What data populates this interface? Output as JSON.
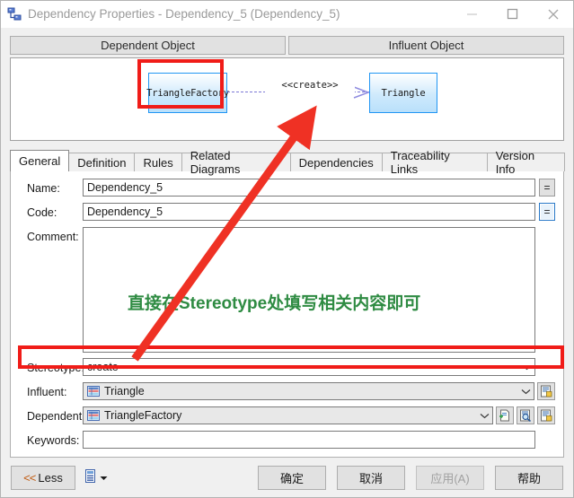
{
  "window": {
    "title": "Dependency Properties - Dependency_5 (Dependency_5)",
    "icon": "dependency-icon",
    "minimize_label": "minimize-icon",
    "maximize_label": "maximize-icon",
    "close_label": "close-icon"
  },
  "object_header": {
    "dependent_label": "Dependent Object",
    "influent_label": "Influent Object"
  },
  "diagram": {
    "source_class": "TriangleFactory",
    "target_class": "Triangle",
    "stereotype_label": "<<create>>",
    "box_fill": "#bfe4fb",
    "box_border": "#2196f3",
    "link_color": "#7b77d6",
    "highlight_color": "#f01c18"
  },
  "tabs": [
    {
      "label": "General",
      "active": true
    },
    {
      "label": "Definition",
      "active": false
    },
    {
      "label": "Rules",
      "active": false
    },
    {
      "label": "Related Diagrams",
      "active": false
    },
    {
      "label": "Dependencies",
      "active": false
    },
    {
      "label": "Traceability Links",
      "active": false
    },
    {
      "label": "Version Info",
      "active": false
    }
  ],
  "form": {
    "name_label": "Name:",
    "name_value": "Dependency_5",
    "name_eq": "=",
    "code_label": "Code:",
    "code_value": "Dependency_5",
    "code_eq": "=",
    "comment_label": "Comment:",
    "comment_value": "",
    "stereotype_label": "Stereotype:",
    "stereotype_value": "create",
    "influent_label": "Influent:",
    "influent_value": "Triangle",
    "dependent_label": "Dependent:",
    "dependent_value": "TriangleFactory",
    "keywords_label": "Keywords:",
    "keywords_value": ""
  },
  "annotation": {
    "text": "直接在Stereotype处填写相关内容即可",
    "color": "#2e8b42",
    "arrow_color": "#ef3124"
  },
  "footer": {
    "less_chevrons": "<<",
    "less_label": "Less",
    "report_icon": "report-icon",
    "report_dropdown": "▼",
    "ok_label": "确定",
    "cancel_label": "取消",
    "apply_label": "应用(A)",
    "apply_disabled": true,
    "help_label": "帮助"
  }
}
